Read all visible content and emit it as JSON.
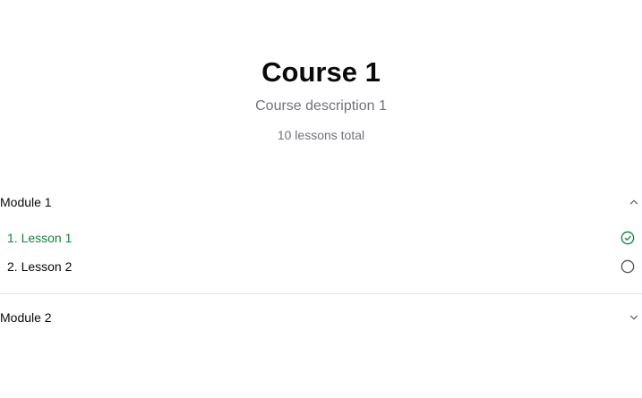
{
  "course": {
    "title": "Course 1",
    "description": "Course description 1",
    "lesson_count": "10 lessons total"
  },
  "modules": [
    {
      "title": "Module 1",
      "expanded": true,
      "chevron_icon": "chevron-up-icon",
      "lessons": [
        {
          "label": "1. Lesson 1",
          "completed": true,
          "icon": "check-circle-icon",
          "color": "#15803d"
        },
        {
          "label": "2. Lesson 2",
          "completed": false,
          "icon": "circle-icon",
          "color": "#0a0a0a"
        }
      ]
    },
    {
      "title": "Module 2",
      "expanded": false,
      "chevron_icon": "chevron-down-icon",
      "lessons": []
    }
  ],
  "colors": {
    "completed": "#15803d",
    "muted_text": "#71717a",
    "divider": "#e4e4e7",
    "text": "#0a0a0a"
  }
}
